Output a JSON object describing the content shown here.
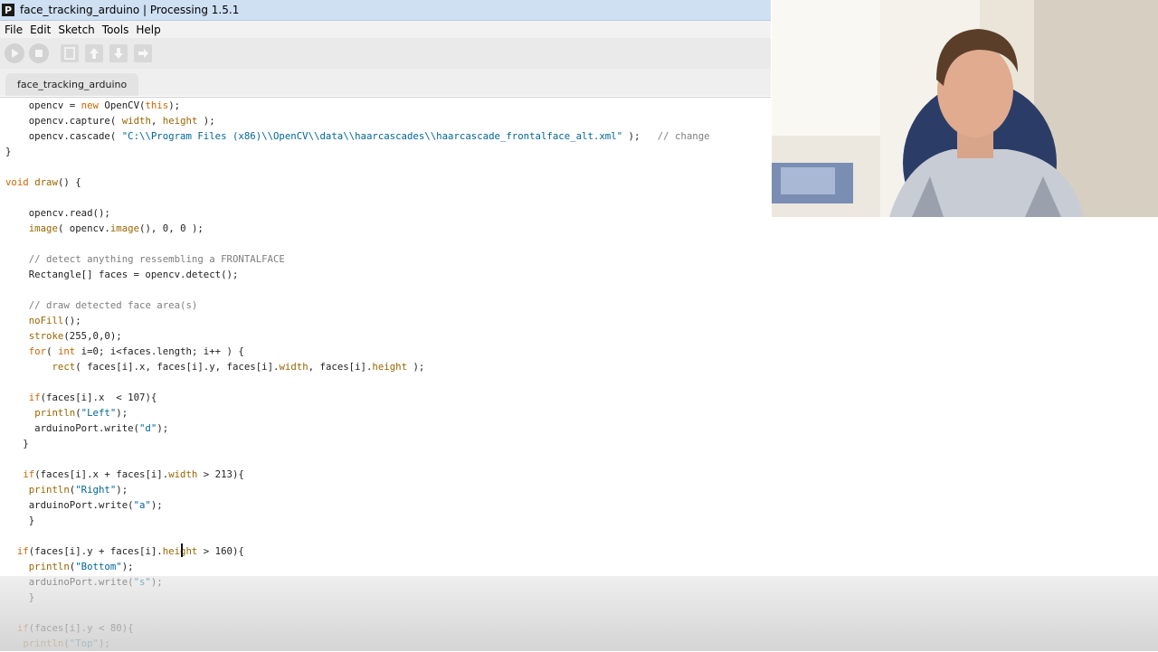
{
  "window": {
    "title": "face_tracking_arduino | Processing 1.5.1",
    "app_icon": "P"
  },
  "menu": [
    "File",
    "Edit",
    "Sketch",
    "Tools",
    "Help"
  ],
  "toolbar": {
    "buttons": [
      "run-icon",
      "stop-icon",
      "new-icon",
      "open-icon",
      "save-icon",
      "export-icon"
    ]
  },
  "tab": {
    "label": "face_tracking_arduino"
  },
  "code_lines": [
    "    opencv = new OpenCV(this);",
    "    opencv.capture( width, height );",
    "    opencv.cascade( \"C:\\\\Program Files (x86)\\\\OpenCV\\\\data\\\\haarcascades\\\\haarcascade_frontalface_alt.xml\" );   // change",
    "}",
    "",
    "void draw() {",
    "",
    "    opencv.read();",
    "    image( opencv.image(), 0, 0 );",
    "",
    "    // detect anything ressembling a FRONTALFACE",
    "    Rectangle[] faces = opencv.detect();",
    "",
    "    // draw detected face area(s)",
    "    noFill();",
    "    stroke(255,0,0);",
    "    for( int i=0; i<faces.length; i++ ) {",
    "        rect( faces[i].x, faces[i].y, faces[i].width, faces[i].height );",
    "",
    "    if(faces[i].x  < 107){",
    "     println(\"Left\");",
    "     arduinoPort.write(\"d\");",
    "   }",
    "",
    "   if(faces[i].x + faces[i].width > 213){",
    "    println(\"Right\");",
    "    arduinoPort.write(\"a\");",
    "    }",
    "",
    "  if(faces[i].y + faces[i].height > 160){",
    "    println(\"Bottom\");",
    "    arduinoPort.write(\"s\");",
    "    }",
    "",
    "  if(faces[i].y < 80){",
    "   println(\"Top\");"
  ],
  "colors": {
    "titlebar": "#cfe0f3",
    "keyword": "#cc6600",
    "function": "#996600",
    "comment": "#7e7e7e",
    "string": "#006699"
  }
}
